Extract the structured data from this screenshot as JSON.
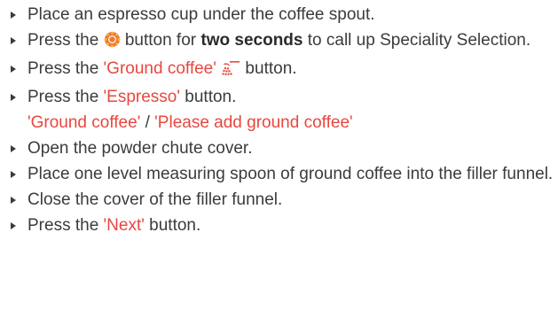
{
  "steps": [
    {
      "text": "Place an espresso cup under the coffee spout."
    },
    {
      "pre": "Press the ",
      "icon": "gear-icon",
      "mid": " button for ",
      "bold": "two seconds",
      "post": " to call up Speciality Selection."
    },
    {
      "pre": "Press the ",
      "red": "'Ground coffee'",
      "icon": "ground-coffee-icon",
      "post": " button."
    },
    {
      "pre": "Press the ",
      "red": "'Espresso'",
      "post": " button.",
      "line2_red_a": "'Ground coffee'",
      "line2_sep": " / ",
      "line2_red_b": "'Please add ground coffee'"
    },
    {
      "text": "Open the powder chute cover."
    },
    {
      "text": "Place one level measuring spoon of ground coffee into the filler funnel."
    },
    {
      "text": "Close the cover of the filler funnel."
    },
    {
      "pre": "Press the ",
      "red": "'Next'",
      "post": " button."
    }
  ],
  "colors": {
    "text": "#3b3b3b",
    "accent": "#e8473f"
  }
}
